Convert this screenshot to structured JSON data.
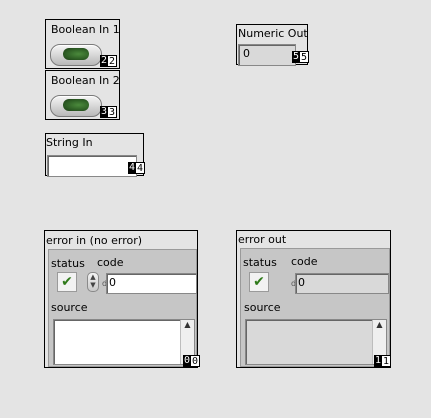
{
  "boolean_in_1": {
    "label": "Boolean In 1",
    "tag": [
      "2",
      "2"
    ]
  },
  "boolean_in_2": {
    "label": "Boolean In 2",
    "tag": [
      "3",
      "3"
    ]
  },
  "string_in": {
    "label": "String In",
    "value": "",
    "tag": [
      "4",
      "4"
    ]
  },
  "numeric_out": {
    "label": "Numeric Out",
    "value": "0",
    "tag": [
      "5",
      "5"
    ]
  },
  "error_in": {
    "label": "error in (no error)",
    "status_label": "status",
    "code_label": "code",
    "code_prefix": "d",
    "code_value": "0",
    "source_label": "source",
    "tag": [
      "0",
      "0"
    ]
  },
  "error_out": {
    "label": "error out",
    "status_label": "status",
    "code_label": "code",
    "code_prefix": "d",
    "code_value": "0",
    "source_label": "source",
    "tag": [
      "1",
      "1"
    ]
  },
  "colors": {
    "background": "#e4e4e4",
    "led_green": "#2d5d24",
    "check_green": "#2f7a1a"
  },
  "icons": {
    "status_check": "✔"
  }
}
